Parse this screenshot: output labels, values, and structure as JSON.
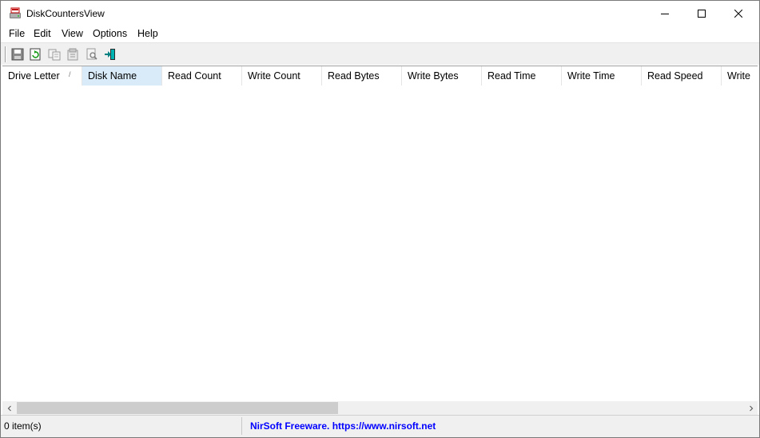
{
  "window": {
    "title": "DiskCountersView",
    "icon": "disk-counter-app-icon"
  },
  "menu": {
    "items": [
      "File",
      "Edit",
      "View",
      "Options",
      "Help"
    ]
  },
  "toolbar": {
    "buttons": [
      {
        "name": "save-icon",
        "tooltip": ""
      },
      {
        "name": "refresh-icon",
        "tooltip": ""
      },
      {
        "name": "copy-icon",
        "tooltip": ""
      },
      {
        "name": "properties-icon",
        "tooltip": ""
      },
      {
        "name": "find-icon",
        "tooltip": ""
      },
      {
        "name": "exit-icon",
        "tooltip": ""
      }
    ]
  },
  "table": {
    "columns": [
      "Drive Letter",
      "Disk Name",
      "Read Count",
      "Write Count",
      "Read Bytes",
      "Write Bytes",
      "Read Time",
      "Write Time",
      "Read Speed",
      "Write"
    ],
    "sorted_column": "Drive Letter",
    "sort_indicator": "/",
    "highlighted_column": "Disk Name",
    "rows": []
  },
  "statusbar": {
    "items_text": "0 item(s)",
    "link_text": "NirSoft Freeware. https://www.nirsoft.net"
  },
  "colors": {
    "link": "#0000ff",
    "header_highlight": "#d9ebf9",
    "chrome_bg": "#f0f0f0"
  }
}
